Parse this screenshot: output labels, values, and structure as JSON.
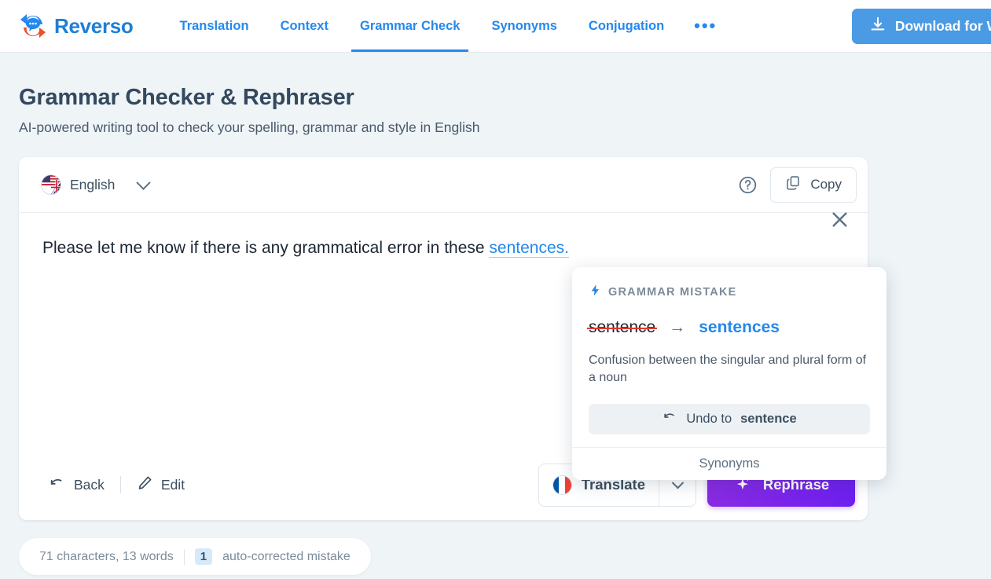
{
  "header": {
    "brand": "Reverso",
    "logo_icon": "reverso-circular-arrow-speech-bubble-logo",
    "nav": [
      {
        "label": "Translation",
        "active": false
      },
      {
        "label": "Context",
        "active": false
      },
      {
        "label": "Grammar Check",
        "active": true
      },
      {
        "label": "Synonyms",
        "active": false
      },
      {
        "label": "Conjugation",
        "active": false
      }
    ],
    "more_label": "•••",
    "download": {
      "label": "Download for W",
      "icon": "download-icon",
      "color": "#4a9ae4"
    }
  },
  "page": {
    "title": "Grammar Checker & Rephraser",
    "subtitle": "AI-powered writing tool to check your spelling, grammar and style in English"
  },
  "editor_card": {
    "language": {
      "label": "English",
      "flag_icon": "uk-us-combined-flag-icon",
      "chevron_icon": "chevron-down-icon"
    },
    "help_icon": "question-mark-circle-icon",
    "copy": {
      "label": "Copy",
      "icon": "copy-icon"
    },
    "clear_icon": "close-x-icon",
    "text": {
      "before": "Please let me know if there is any grammatical error in these ",
      "highlight": "sentences",
      "after": "."
    },
    "actions": {
      "back": {
        "label": "Back",
        "icon": "undo-arrow-icon"
      },
      "edit": {
        "label": "Edit",
        "icon": "pencil-icon"
      },
      "translate": {
        "label": "Translate",
        "flag_icon": "france-flag-icon",
        "caret_icon": "chevron-down-icon"
      },
      "rephrase": {
        "label": "Rephrase",
        "icon": "sparkle-icon",
        "color": "#6d1ff0"
      }
    }
  },
  "stats": {
    "counts": "71 characters, 13 words",
    "badge": "1",
    "mistakes_label": "auto-corrected mistake"
  },
  "popup": {
    "kicker": "GRAMMAR MISTAKE",
    "kicker_icon": "lightning-bolt-icon",
    "old_word": "sentence",
    "arrow": "→",
    "new_word": "sentences",
    "description": "Confusion between the singular and plural form of a noun",
    "undo": {
      "prefix": "Undo to",
      "word": "sentence",
      "icon": "undo-arrow-icon"
    },
    "footer_link": "Synonyms"
  }
}
